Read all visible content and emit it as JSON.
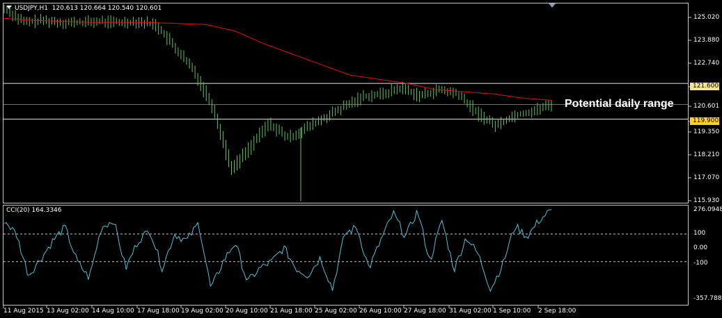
{
  "window": {
    "title_symbol": "USDJPY,H1",
    "ohlc": "120.613 120.664 120.540 120.601",
    "cci_title": "CCI(20) 164.3346"
  },
  "price_axis": [
    "125.020",
    "123.880",
    "122.740",
    "121.600",
    "120.601",
    "119.900",
    "119.350",
    "118.210",
    "117.070",
    "115.930"
  ],
  "cci_axis": [
    "276.0948",
    "100",
    "0.00",
    "-100",
    "-357.7888"
  ],
  "time_axis": [
    "11 Aug 2015",
    "13 Aug 02:00",
    "14 Aug 10:00",
    "17 Aug 18:00",
    "19 Aug 02:00",
    "20 Aug 10:00",
    "21 Aug 18:00",
    "25 Aug 02:00",
    "26 Aug 10:00",
    "27 Aug 18:00",
    "31 Aug 02:00",
    "1 Sep 10:00",
    "2 Sep 18:00"
  ],
  "levels": {
    "high": "121.600",
    "low": "119.900",
    "current": "120.601"
  },
  "annotation": "Potential daily range",
  "colors": {
    "bars": "#5fc85f",
    "ma": "#e01010",
    "cci": "#4fc3d9",
    "high_tag": "#f2e58c",
    "low_tag": "#ffd21f"
  },
  "chart_data": [
    {
      "type": "line",
      "series": [
        {
          "values": [
            125.15,
            124.5,
            124.6,
            124.5,
            124.5,
            124.55,
            124.5,
            124.55,
            124.4,
            123.3,
            122.2,
            120.5,
            117.5,
            118.6,
            119.7,
            119.0,
            119.5,
            120.0,
            120.5,
            121.0,
            121.1,
            121.4,
            121.0,
            121.3,
            121.1,
            120.2,
            119.6,
            120.1,
            120.3,
            120.6
          ]
        },
        {
          "values": [
            124.7,
            124.6,
            124.55,
            124.5,
            124.5,
            124.5,
            124.45,
            124.4,
            124.1,
            123.5,
            123.0,
            122.5,
            122.0,
            121.8,
            121.6,
            121.3,
            121.2,
            121.1,
            120.9,
            120.8
          ]
        }
      ],
      "ylim": [
        115.93,
        125.4
      ]
    },
    {
      "type": "line",
      "series": [
        {
          "name": "CCI(20)",
          "values": [
            200,
            100,
            -200,
            -80,
            50,
            150,
            -100,
            -220,
            150,
            200,
            -150,
            50,
            130,
            -150,
            100,
            50,
            180,
            -300,
            -100,
            40,
            -250,
            -150,
            -100,
            0,
            -150,
            -200,
            -70,
            -300,
            100,
            150,
            -150,
            60,
            250,
            80,
            270,
            -100,
            200,
            -160,
            80,
            -50,
            -300,
            -120,
            160,
            80,
            200,
            276
          ]
        }
      ],
      "ylim": [
        -357.7888,
        276.0948
      ]
    }
  ]
}
